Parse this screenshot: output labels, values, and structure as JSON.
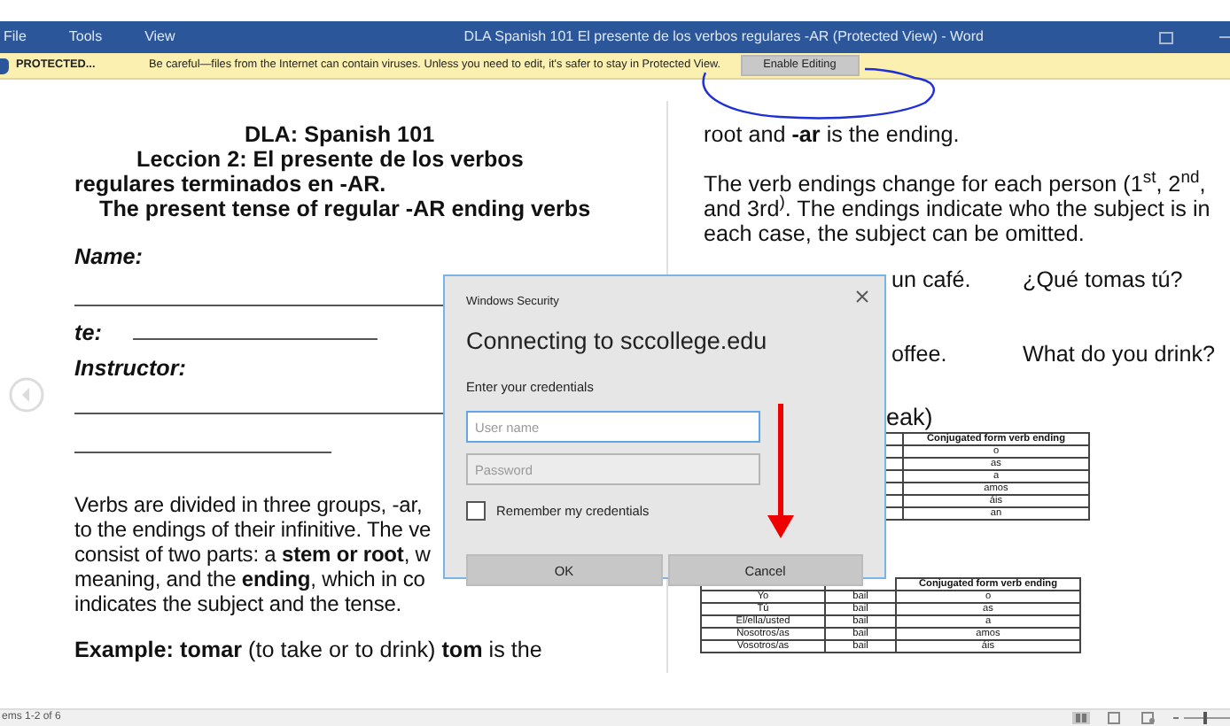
{
  "window": {
    "title": "DLA Spanish 101 El presente de los verbos regulares -AR (Protected View) - Word",
    "menu": [
      "File",
      "Tools",
      "View"
    ]
  },
  "protected_bar": {
    "label": "PROTECTED...",
    "message": "Be careful—files from the Internet can contain viruses. Unless you need to edit, it's safer to stay in Protected View.",
    "button": "Enable Editing"
  },
  "left_page": {
    "heading": [
      "DLA: Spanish 101",
      "Leccion 2:  El presente de los verbos",
      "regulares terminados en -AR.",
      "The present tense of regular -AR ending verbs"
    ],
    "name_label": "Name:",
    "date_label": "te:",
    "instructor_label": "Instructor:",
    "paragraph": [
      "Verbs are divided in three groups, -ar,",
      "to the endings of their infinitive. The ve",
      "consist of two parts: a **stem or root**, w",
      "meaning, and the **ending**, which in co",
      "indicates the subject and the tense."
    ],
    "example": "**Example:**   **tomar** (to take or to drink)    **tom** is the"
  },
  "right_page": {
    "first_line": "root and **-ar** is the ending.",
    "paragraph": [
      "The verb endings change for each person (1$^{st}$, 2$^{nd}$,",
      "and 3rd$^{)}$. The endings indicate who the subject is in",
      "each case, the subject can be omitted."
    ],
    "example_rows": [
      {
        "spanish": "un café.",
        "question": "¿Qué tomas tú?"
      },
      {
        "spanish": "offee.",
        "question": "What do you drink?"
      }
    ],
    "fragment": "eak)",
    "table_1": {
      "header": "Conjugated form verb ending",
      "rows": [
        "o",
        "as",
        "a",
        "amos",
        "áis",
        "an"
      ]
    },
    "table_2": {
      "header": "Conjugated form verb ending",
      "rows": [
        [
          "Yo",
          "bail",
          "o"
        ],
        [
          "Tú",
          "bail",
          "as"
        ],
        [
          "El/ella/usted",
          "bail",
          "a"
        ],
        [
          "Nosotros/as",
          "bail",
          "amos"
        ],
        [
          "Vosotros/as",
          "bail",
          "áis"
        ]
      ]
    }
  },
  "dialog": {
    "caption": "Windows Security",
    "title": "Connecting to sccollege.edu",
    "prompt": "Enter your credentials",
    "fields": [
      {
        "placeholder": "User name",
        "focused": true
      },
      {
        "placeholder": "Password",
        "focused": false
      }
    ],
    "remember": {
      "label": "Remember my credentials",
      "checked": false
    },
    "buttons": [
      "OK",
      "Cancel"
    ]
  },
  "status_bar": {
    "text": "ems 1-2 of 6",
    "zoom": {
      "level": 0.45
    }
  }
}
